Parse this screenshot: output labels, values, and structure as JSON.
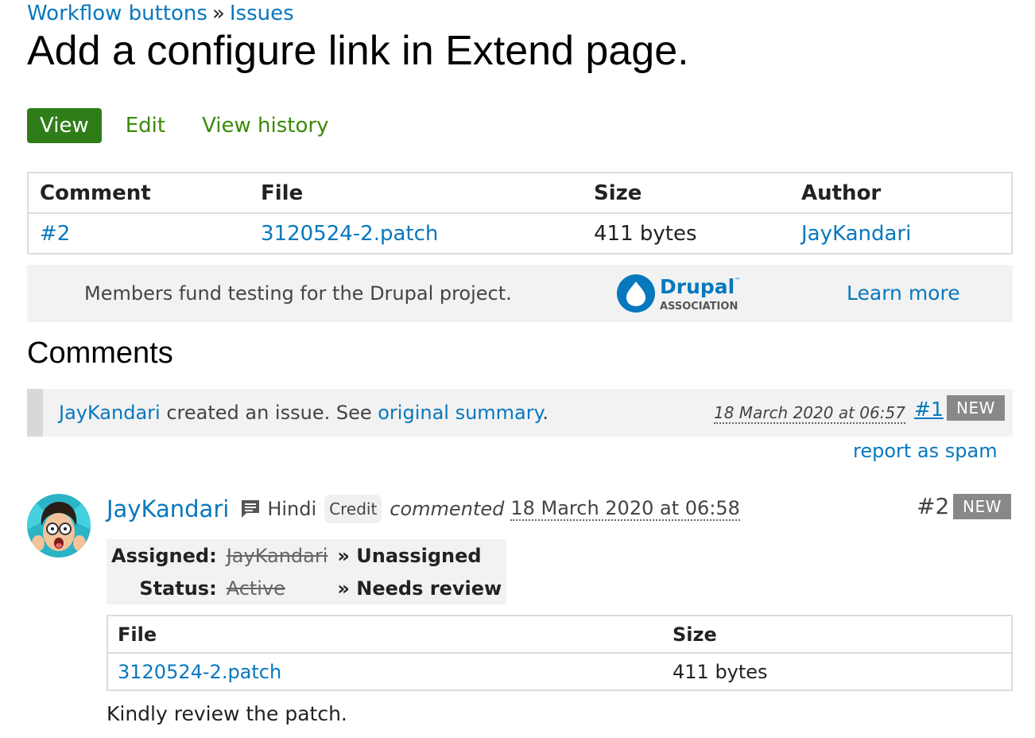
{
  "breadcrumb": {
    "items": [
      "Workflow buttons",
      "Issues"
    ],
    "separator": "»"
  },
  "page_title": "Add a configure link in Extend page.",
  "tabs": [
    {
      "label": "View",
      "active": true
    },
    {
      "label": "Edit",
      "active": false
    },
    {
      "label": "View history",
      "active": false
    }
  ],
  "file_table": {
    "headers": [
      "Comment",
      "File",
      "Size",
      "Author"
    ],
    "rows": [
      {
        "comment": "#2",
        "file": "3120524-2.patch",
        "size": "411 bytes",
        "author": "JayKandari"
      }
    ]
  },
  "funding": {
    "text": "Members fund testing for the Drupal project.",
    "logo": {
      "wordmark": "Drupal",
      "tm": "™",
      "subtitle": "ASSOCIATION"
    },
    "learn_more": "Learn more"
  },
  "comments_heading": "Comments",
  "system_comment": {
    "author": "JayKandari",
    "text_before": " created an issue. See ",
    "link": "original summary",
    "text_after": ".",
    "date": "18 March 2020 at 06:57",
    "number": "#1",
    "badge": "NEW",
    "report": "report as spam"
  },
  "comment": {
    "avatar_icon": "user-avatar-icon",
    "author": "JayKandari",
    "language_icon": "comment-icon",
    "language": "Hindi",
    "credit": "Credit",
    "commented": "commented",
    "date": "18 March 2020 at 06:58",
    "number": "#2",
    "badge": "NEW",
    "changes": [
      {
        "label": "Assigned:",
        "old": "JayKandari",
        "new": "» Unassigned"
      },
      {
        "label": "Status:",
        "old": "Active",
        "new": "» Needs review"
      }
    ],
    "files": {
      "headers": [
        "File",
        "Size"
      ],
      "rows": [
        {
          "file": "3120524-2.patch",
          "size": "411 bytes"
        }
      ]
    },
    "body": "Kindly review the patch."
  },
  "colors": {
    "link": "#0678be",
    "tab_active_bg": "#2f7d18",
    "tab_text": "#3b8a06",
    "badge_bg": "#888888",
    "drupal_blue": "#0678be"
  }
}
